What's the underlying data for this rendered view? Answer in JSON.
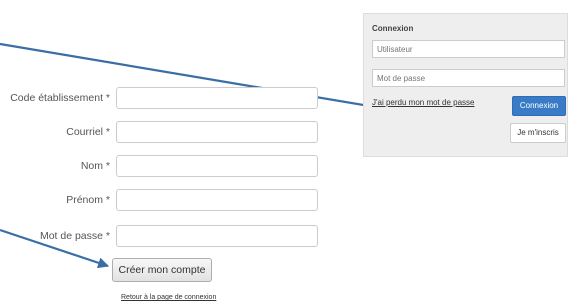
{
  "login": {
    "title": "Connexion",
    "username_placeholder": "Utilisateur",
    "password_placeholder": "Mot de passe",
    "forgot_link": "J'ai perdu mon mot de passe",
    "connexion_button": "Connexion",
    "signup_button": "Je m'inscris"
  },
  "registration": {
    "fields": [
      {
        "label": "Code établissement *",
        "value": ""
      },
      {
        "label": "Courriel *",
        "value": ""
      },
      {
        "label": "Nom *",
        "value": ""
      },
      {
        "label": "Prénom *",
        "value": ""
      },
      {
        "label": "Mot de passe *",
        "value": ""
      }
    ],
    "create_button": "Créer mon compte",
    "back_link": "Retour à la page de connexion"
  },
  "colors": {
    "arrow": "#3a6ea5",
    "primary_button": "#3a7bc8",
    "panel_background": "#eeeeee"
  }
}
